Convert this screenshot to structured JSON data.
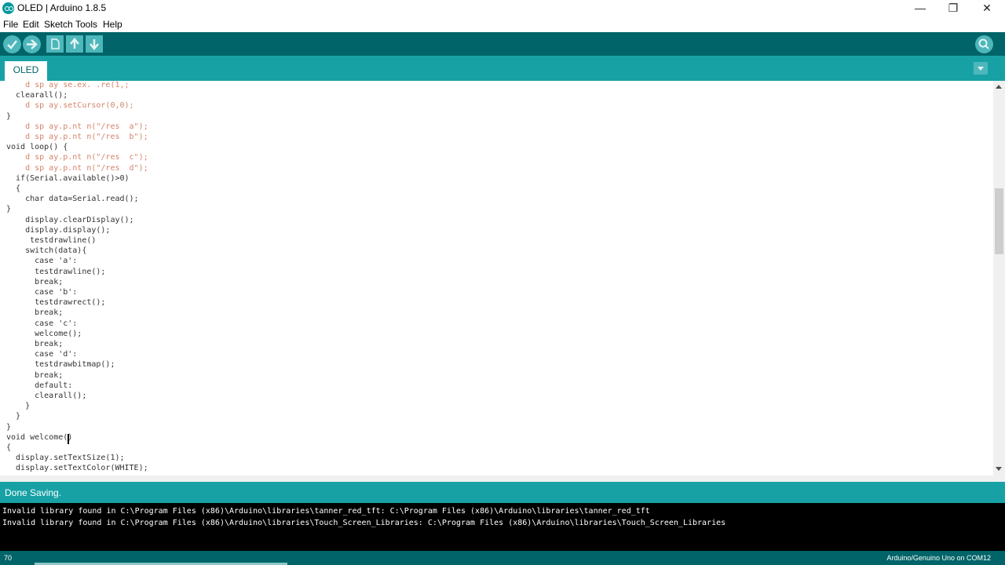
{
  "window": {
    "title": "OLED | Arduino 1.8.5",
    "minimize": "—",
    "restore": "❐",
    "close": "✕"
  },
  "menu": [
    "File",
    "Edit",
    "Sketch",
    "Tools",
    "Help"
  ],
  "toolbar": {
    "verify_icon": "checkmark-icon",
    "upload_icon": "right-arrow-icon",
    "new_icon": "document-icon",
    "open_icon": "up-arrow-icon",
    "save_icon": "down-arrow-icon",
    "serial_monitor_icon": "magnifier-icon"
  },
  "tabs": [
    {
      "label": "OLED"
    }
  ],
  "editor": {
    "lines": [
      {
        "text": "    d sp ay se.ex. .re(1,;",
        "ghost": true
      },
      {
        "text": "  clearall();",
        "ghost": false
      },
      {
        "text": "    d sp ay.setCursor(0,0);",
        "ghost": true
      },
      {
        "text": "}",
        "ghost": false
      },
      {
        "text": "    d sp ay.p.nt n(\"/res  a\");",
        "ghost": true
      },
      {
        "text": "    d sp ay.p.nt n(\"/res  b\");",
        "ghost": true
      },
      {
        "text": "void loop() {",
        "ghost": false
      },
      {
        "text": "    d sp ay.p.nt n(\"/res  c\");",
        "ghost": true
      },
      {
        "text": "    d sp ay.p.nt n(\"/res  d\");",
        "ghost": true
      },
      {
        "text": "  if(Serial.available()>0)",
        "ghost": false
      },
      {
        "text": "  {",
        "ghost": false
      },
      {
        "text": "    char data=Serial.read();",
        "ghost": false
      },
      {
        "text": "}",
        "ghost": false
      },
      {
        "text": "    display.clearDisplay();",
        "ghost": false
      },
      {
        "text": "    display.display();",
        "ghost": false
      },
      {
        "text": "     testdrawline()",
        "ghost": false
      },
      {
        "text": "    switch(data){",
        "ghost": false
      },
      {
        "text": "      case 'a':",
        "ghost": false
      },
      {
        "text": "      testdrawline();",
        "ghost": false
      },
      {
        "text": "      break;",
        "ghost": false
      },
      {
        "text": "      case 'b':",
        "ghost": false
      },
      {
        "text": "      testdrawrect();",
        "ghost": false
      },
      {
        "text": "      break;",
        "ghost": false
      },
      {
        "text": "      case 'c':",
        "ghost": false
      },
      {
        "text": "      welcome();",
        "ghost": false
      },
      {
        "text": "      break;",
        "ghost": false
      },
      {
        "text": "      case 'd':",
        "ghost": false
      },
      {
        "text": "      testdrawbitmap();",
        "ghost": false
      },
      {
        "text": "      break;",
        "ghost": false
      },
      {
        "text": "      default:",
        "ghost": false
      },
      {
        "text": "      clearall();",
        "ghost": false
      },
      {
        "text": "    }",
        "ghost": false
      },
      {
        "text": "  }",
        "ghost": false
      },
      {
        "text": "}",
        "ghost": false
      },
      {
        "text": "void welcome()",
        "ghost": false
      },
      {
        "text": "{",
        "ghost": false
      },
      {
        "text": "  display.setTextSize(1);",
        "ghost": false
      },
      {
        "text": "  display.setTextColor(WHITE);",
        "ghost": false
      }
    ]
  },
  "status": {
    "text": "Done Saving."
  },
  "console": {
    "lines": [
      "Invalid library found in C:\\Program Files (x86)\\Arduino\\libraries\\tanner_red_tft: C:\\Program Files (x86)\\Arduino\\libraries\\tanner_red_tft",
      "Invalid library found in C:\\Program Files (x86)\\Arduino\\libraries\\Touch_Screen_Libraries: C:\\Program Files (x86)\\Arduino\\libraries\\Touch_Screen_Libraries"
    ]
  },
  "footer": {
    "line": "70",
    "board": "Arduino/Genuino Uno on COM12"
  },
  "colors": {
    "teal_dark": "#006468",
    "teal": "#17a1a5",
    "teal_light": "#4db7bb"
  }
}
